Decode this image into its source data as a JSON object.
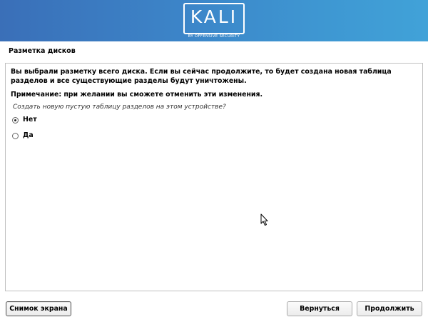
{
  "header": {
    "logo_text": "KALI",
    "logo_subtitle": "BY OFFENSIVE SECURITY",
    "banner_color": "#3c86c9"
  },
  "page": {
    "title": "Разметка дисков"
  },
  "main": {
    "warning": "Вы выбрали разметку всего диска. Если вы сейчас продолжите, то будет создана новая таблица разделов и все существующие разделы будут уничтожены.",
    "note": "Примечание: при желании вы сможете отменить эти изменения.",
    "question": "Создать новую пустую таблицу разделов на этом устройстве?",
    "options": [
      {
        "label": "Нет",
        "selected": true
      },
      {
        "label": "Да",
        "selected": false
      }
    ]
  },
  "buttons": {
    "screenshot": "Снимок экрана",
    "back": "Вернуться",
    "continue": "Продолжить"
  },
  "icons": {
    "cursor": "mouse-pointer-icon",
    "radio_selected": "radio-selected-icon",
    "radio_empty": "radio-unselected-icon"
  }
}
